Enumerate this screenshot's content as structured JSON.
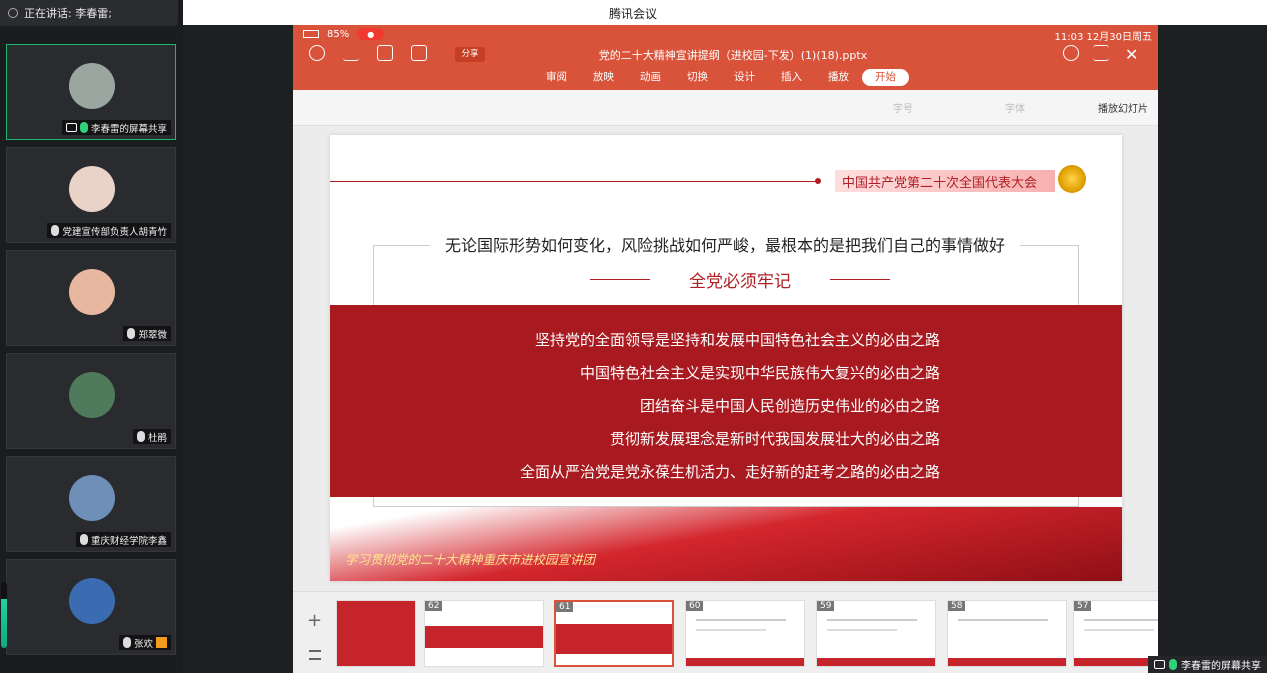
{
  "window": {
    "title": "腾讯会议"
  },
  "speaker": {
    "text": "正在讲话: 李春雷;"
  },
  "participants": [
    {
      "name": "李春雷的屏幕共享",
      "active": true,
      "mic": "on",
      "avatar_color": "#9aa7a0"
    },
    {
      "name": "党建宣传部负责人胡青竹",
      "active": false,
      "mic": "off",
      "avatar_color": "#e9d3c8"
    },
    {
      "name": "郑翠微",
      "active": false,
      "mic": "off",
      "avatar_color": "#e7b89f"
    },
    {
      "name": "杜鹃",
      "active": false,
      "mic": "off",
      "avatar_color": "#4f7a5c"
    },
    {
      "name": "重庆财经学院李鑫",
      "active": false,
      "mic": "off",
      "avatar_color": "#6d8fb8"
    },
    {
      "name": "张欢",
      "active": false,
      "mic": "off",
      "avatar_color": "#3b6bb0"
    }
  ],
  "volume_level": 0.75,
  "share": {
    "status_left": "11:03  12月30日周五",
    "battery": "85%",
    "filename": "党的二十大精神宣讲提纲（进校园-下发）(1)(18).pptx",
    "share_label": "分享",
    "tabs": [
      "开始",
      "插入",
      "设计",
      "切换",
      "动画",
      "放映",
      "播放",
      "审阅"
    ],
    "selected_tab": "开始",
    "ribbon_left": "播放幻灯片",
    "ribbon_font": "字体",
    "ribbon_size": "字号",
    "slide": {
      "header": "中国共产党第二十次全国代表大会",
      "line1": "无论国际形势如何变化，风险挑战如何严峻，最根本的是把我们自己的事情做好",
      "line2": "全党必须牢记",
      "items": [
        "坚持党的全面领导是坚持和发展中国特色社会主义的必由之路",
        "中国特色社会主义是实现中华民族伟大复兴的必由之路",
        "团结奋斗是中国人民创造历史伟业的必由之路",
        "贯彻新发展理念是新时代我国发展壮大的必由之路",
        "全面从严治党是党永葆生机活力、走好新的赶考之路的必由之路"
      ],
      "footer": "学习贯彻党的二十大精神重庆市进校园宣讲团"
    },
    "thumbnails": [
      "57",
      "58",
      "59",
      "60",
      "61",
      "62",
      ""
    ]
  },
  "bottom_label": "李春雷的屏幕共享"
}
